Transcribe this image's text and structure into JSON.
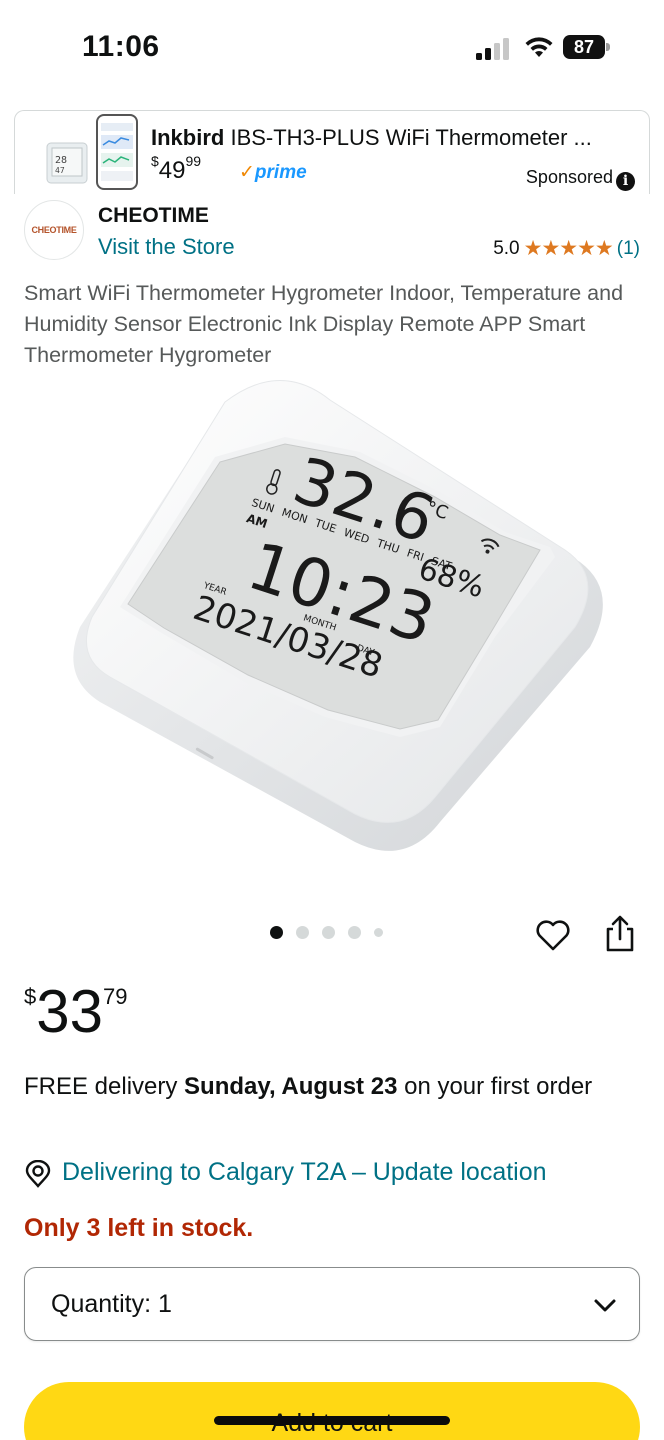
{
  "status_bar": {
    "time": "11:06",
    "battery": "87"
  },
  "ad": {
    "brand": "Inkbird",
    "title_rest": " IBS-TH3-PLUS WiFi Thermometer ...",
    "price_symbol": "$",
    "price_whole": "49",
    "price_cents": "99",
    "prime_check": "✓",
    "prime_label": "prime",
    "sponsored_label": "Sponsored",
    "info_glyph": "i"
  },
  "brand": {
    "logo_text": "CHEOTIME",
    "name": "CHEOTIME",
    "store_link": "Visit the Store",
    "rating_value": "5.0",
    "stars": "★★★★★",
    "rating_count": "(1)"
  },
  "product": {
    "title": "Smart WiFi Thermometer Hygrometer Indoor, Temperature and Humidity Sensor Electronic Ink Display Remote APP Smart Thermometer Hygrometer",
    "display": {
      "temperature": "32.6",
      "temp_unit": "°C",
      "humidity": "68%",
      "time": "10:23",
      "date": "2021/03/28",
      "days": [
        "SUN",
        "MON",
        "TUE",
        "WED",
        "THU",
        "FRI",
        "SAT"
      ],
      "am": "AM",
      "year_label": "YEAR",
      "month_label": "MONTH",
      "day_label": "DAY"
    }
  },
  "carousel": {
    "active_index": 0,
    "count": 5
  },
  "price": {
    "symbol": "$",
    "whole": "33",
    "cents": "79"
  },
  "delivery": {
    "prefix": "FREE delivery ",
    "date": "Sunday, August 23",
    "suffix": " on your first order"
  },
  "location": {
    "text": "Delivering to Calgary T2A – Update location"
  },
  "stock": {
    "text": "Only 3 left in stock."
  },
  "quantity": {
    "label": "Quantity:",
    "value": "1"
  },
  "cart": {
    "label": "Add to cart"
  }
}
